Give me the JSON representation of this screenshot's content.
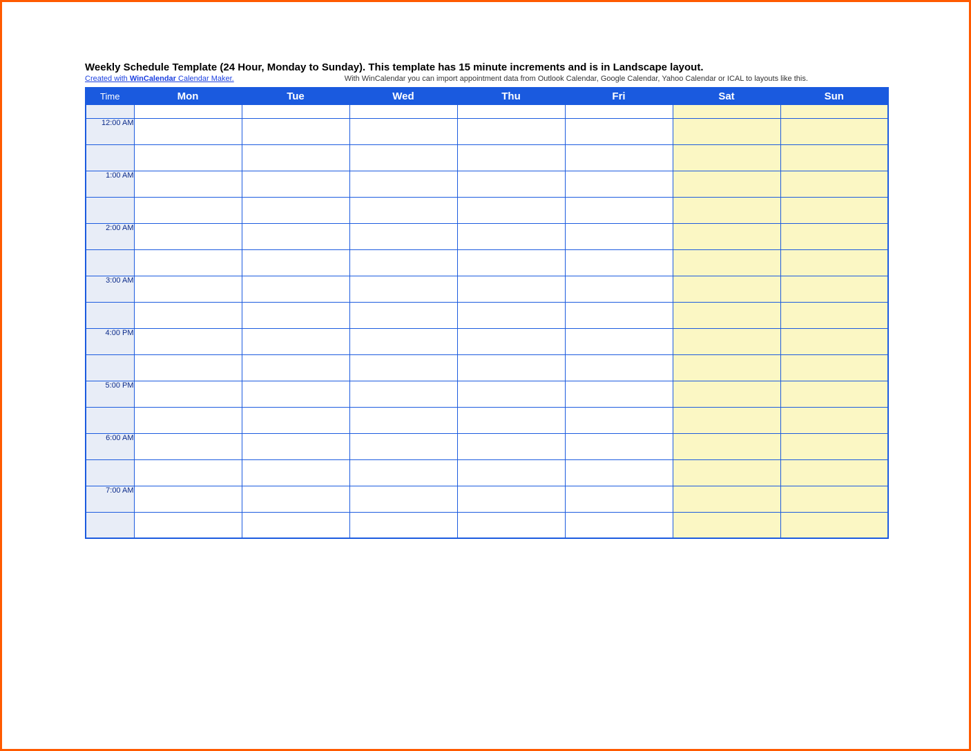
{
  "title": "Weekly Schedule Template (24 Hour, Monday to Sunday).  This template has 15 minute increments and is in Landscape layout.",
  "credit": {
    "prefix": "Created with ",
    "bold": "WinCalendar",
    "suffix": " Calendar Maker."
  },
  "note": "With WinCalendar you can import appointment data from Outlook Calendar, Google Calendar, Yahoo Calendar or ICAL to layouts like this.",
  "headers": {
    "time": "Time",
    "days": [
      "Mon",
      "Tue",
      "Wed",
      "Thu",
      "Fri",
      "Sat",
      "Sun"
    ]
  },
  "weekendIndices": [
    5,
    6
  ],
  "timeSlots": [
    "12:00 AM",
    "1:00 AM",
    "2:00 AM",
    "3:00 AM",
    "4:00 PM",
    "5:00 PM",
    "6:00 AM",
    "7:00 AM"
  ],
  "subRowsPerHour": 2
}
